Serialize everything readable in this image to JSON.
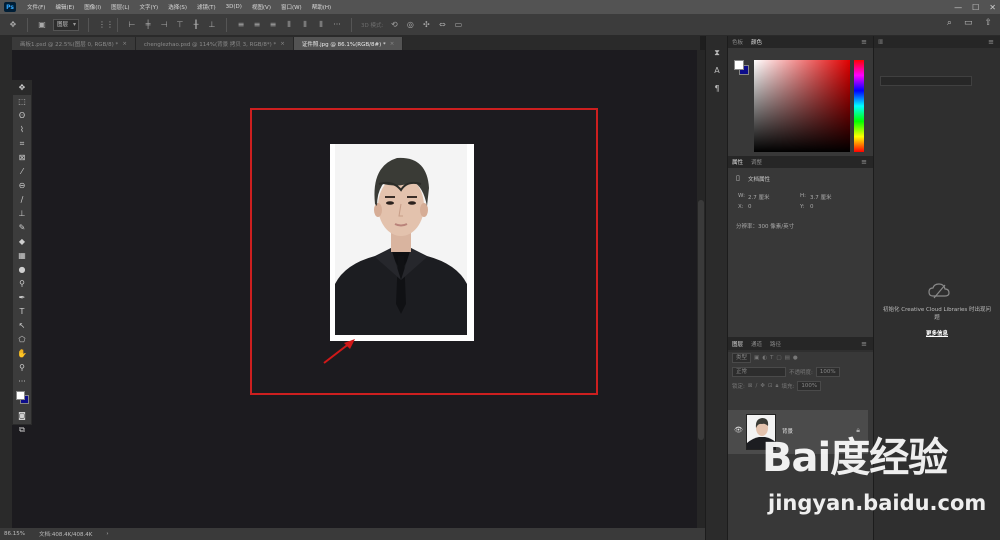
{
  "menubar": {
    "items": [
      "文件(F)",
      "编辑(E)",
      "图像(I)",
      "图层(L)",
      "文字(Y)",
      "选择(S)",
      "滤镜(T)",
      "3D(D)",
      "视图(V)",
      "窗口(W)",
      "帮助(H)"
    ]
  },
  "optbar": {
    "auto_select": "图层",
    "mode_3d": "3D 模式:"
  },
  "tabs": [
    {
      "label": "画板1.psd @ 22.5%(图层 0, RGB/8) *"
    },
    {
      "label": "chenglezhao.psd @ 114%(背景 拷贝 3, RGB/8*) *"
    },
    {
      "label": "证件照.jpg @ 86.1%(RGB/8#) *"
    }
  ],
  "status": {
    "zoom": "86.15%",
    "doc": "文档:408.4K/408.4K"
  },
  "color_panel": {
    "tabs": [
      "色板",
      "颜色"
    ],
    "fg_color": "#ffffff",
    "bg_color": "#0d0d8a"
  },
  "properties": {
    "tabs": [
      "属性",
      "调整"
    ],
    "title": "文档属性",
    "w_label": "W:",
    "w_value": "2.7 厘米",
    "h_label": "H:",
    "h_value": "3.7 厘米",
    "x_label": "X:",
    "x_value": "0",
    "y_label": "Y:",
    "y_value": "0",
    "resolution": "分辨率：300 像素/英寸"
  },
  "layers": {
    "tabs": [
      "图层",
      "通道",
      "路径"
    ],
    "kind": "类型",
    "blend": "正常",
    "opacity_label": "不透明度:",
    "opacity_value": "100%",
    "lock_label": "锁定:",
    "fill_label": "填充:",
    "fill_value": "100%",
    "layer_name": "背景"
  },
  "libraries": {
    "message": "初始化 Creative Cloud Libraries 时出现问题",
    "link": "更多信息"
  },
  "watermark": {
    "logo": "Bai度经验",
    "url": "jingyan.baidu.com"
  }
}
